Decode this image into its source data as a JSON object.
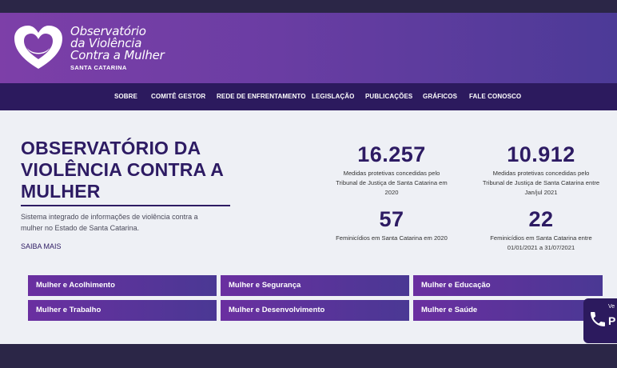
{
  "header": {
    "logo_lines": [
      "Observatório",
      "da Violência",
      "Contra a Mulher"
    ],
    "logo_subtitle": "SANTA CATARINA",
    "logo_icon": "heart-hands-logo"
  },
  "nav": {
    "items": [
      "SOBRE",
      "COMITÊ GESTOR",
      "REDE DE ENFRENTAMENTO",
      "LEGISLAÇÃO",
      "PUBLICAÇÕES",
      "GRÁFICOS",
      "FALE CONOSCO"
    ]
  },
  "hero": {
    "title_lines": [
      "OBSERVATÓRIO DA",
      "VIOLÊNCIA CONTRA A",
      "MULHER"
    ],
    "description_lines": [
      "Sistema integrado de informações de violência contra a",
      "mulher no Estado de Santa Catarina."
    ],
    "saiba_mais": "SAIBA MAIS"
  },
  "stats": [
    {
      "value": "16.257",
      "label_lines": [
        "Medidas protetivas concedidas pelo",
        "Tribunal de Justiça de Santa Catarina em",
        "2020"
      ]
    },
    {
      "value": "10.912",
      "label_lines": [
        "Medidas protetivas concedidas pelo",
        "Tribunal de Justiça de Santa Catarina entre",
        "Jan/jul 2021"
      ]
    },
    {
      "value": "57",
      "label_lines": [
        "Feminicídios em Santa Catarina em 2020"
      ]
    },
    {
      "value": "22",
      "label_lines": [
        "Feminicídios em Santa Catarina entre",
        "01/01/2021 a 31/07/2021"
      ]
    }
  ],
  "tiles": [
    "Mulher e Acolhimento",
    "Mulher e Segurança",
    "Mulher e Educação",
    "Mulher e Trabalho",
    "Mulher e Desenvolvimento",
    "Mulher e Saúde"
  ],
  "phone_widget": {
    "small_text": "Ve",
    "big_text": "P",
    "icon": "phone-icon"
  },
  "colors": {
    "brand_purple": "#2d1b63",
    "header_start": "#7d3fa8",
    "header_end": "#4c3a97",
    "nav_bg": "#2c1a5e"
  }
}
